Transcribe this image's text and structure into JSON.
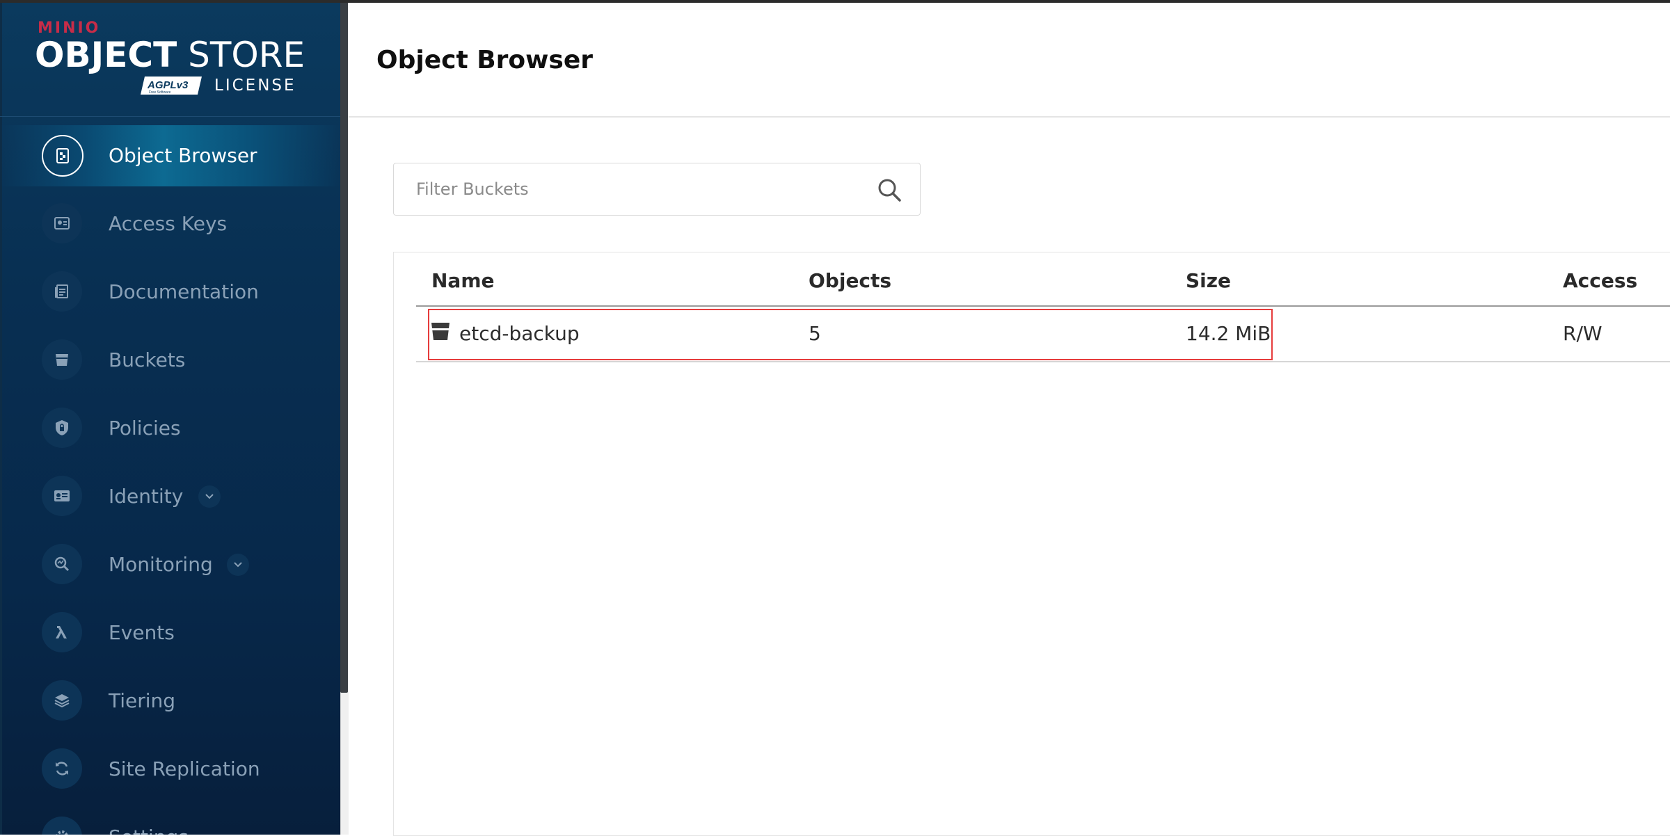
{
  "brand": {
    "minio": "MINIO",
    "object": "OBJECT",
    "store": "STORE",
    "license_badge": "AGPLv3",
    "license_badge_sub": "Free Software",
    "license": "LICENSE",
    "accent_color": "#c72c48"
  },
  "sidebar": {
    "items": [
      {
        "label": "Object Browser",
        "icon": "object-browser-icon",
        "active": true
      },
      {
        "label": "Access Keys",
        "icon": "access-keys-icon"
      },
      {
        "label": "Documentation",
        "icon": "documentation-icon"
      },
      {
        "label": "Buckets",
        "icon": "bucket-icon"
      },
      {
        "label": "Policies",
        "icon": "shield-lock-icon"
      },
      {
        "label": "Identity",
        "icon": "id-card-icon",
        "expandable": true
      },
      {
        "label": "Monitoring",
        "icon": "monitoring-icon",
        "expandable": true
      },
      {
        "label": "Events",
        "icon": "lambda-icon"
      },
      {
        "label": "Tiering",
        "icon": "layers-icon"
      },
      {
        "label": "Site Replication",
        "icon": "replication-icon"
      },
      {
        "label": "Settings",
        "icon": "gear-icon"
      }
    ]
  },
  "header": {
    "title": "Object Browser"
  },
  "search": {
    "placeholder": "Filter Buckets",
    "value": ""
  },
  "table": {
    "columns": [
      "Name",
      "Objects",
      "Size",
      "Access"
    ],
    "rows": [
      {
        "name": "etcd-backup",
        "objects": "5",
        "size": "14.2 MiB",
        "access": "R/W"
      }
    ]
  }
}
